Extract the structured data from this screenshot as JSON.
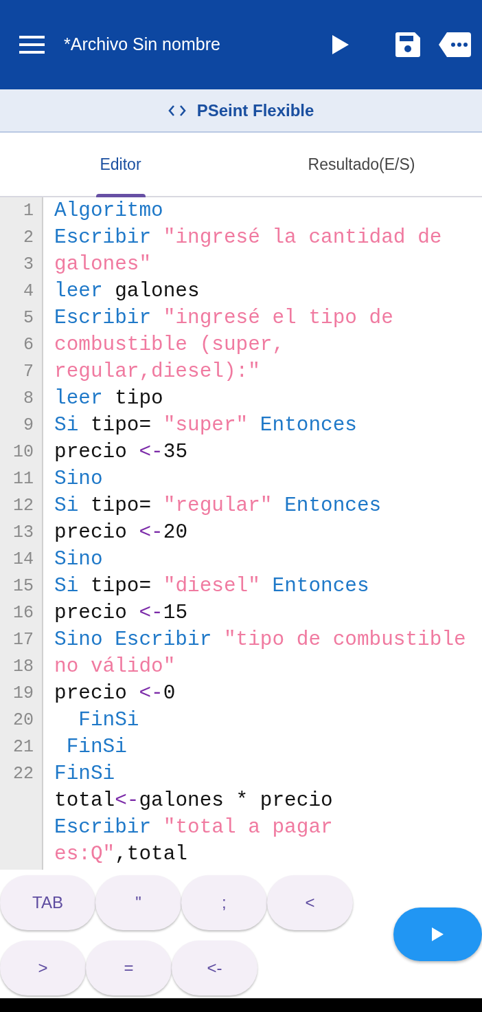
{
  "app_bar": {
    "title": "*Archivo Sin nombre"
  },
  "subheader": {
    "title": "PSeint Flexible"
  },
  "tabs": [
    {
      "label": "Editor",
      "selected": true
    },
    {
      "label": "Resultado(E/S)",
      "selected": false
    }
  ],
  "editor": {
    "rows": [
      {
        "number": "1",
        "tokens": [
          {
            "kind": "keyword",
            "text": "Algoritmo"
          }
        ]
      },
      {
        "number": "2",
        "tokens": [
          {
            "kind": "keyword",
            "text": "Escribir "
          },
          {
            "kind": "string",
            "text": "\"ingresé la cantidad de"
          }
        ]
      },
      {
        "number": "3",
        "tokens": [
          {
            "kind": "string",
            "text": "galones\""
          }
        ]
      },
      {
        "number": "4",
        "tokens": [
          {
            "kind": "keyword",
            "text": "leer "
          },
          {
            "kind": "plain",
            "text": "galones"
          }
        ]
      },
      {
        "number": "5",
        "tokens": [
          {
            "kind": "keyword",
            "text": "Escribir "
          },
          {
            "kind": "string",
            "text": "\"ingresé el tipo de"
          }
        ]
      },
      {
        "number": "6",
        "tokens": [
          {
            "kind": "string",
            "text": "combustible (super,"
          }
        ]
      },
      {
        "number": "7",
        "tokens": [
          {
            "kind": "string",
            "text": "regular,diesel):\""
          }
        ]
      },
      {
        "number": "8",
        "tokens": [
          {
            "kind": "keyword",
            "text": "leer "
          },
          {
            "kind": "plain",
            "text": "tipo"
          }
        ]
      },
      {
        "number": "9",
        "tokens": [
          {
            "kind": "keyword",
            "text": "Si "
          },
          {
            "kind": "plain",
            "text": "tipo= "
          },
          {
            "kind": "string",
            "text": "\"super\" "
          },
          {
            "kind": "keyword",
            "text": "Entonces"
          }
        ]
      },
      {
        "number": "10",
        "tokens": [
          {
            "kind": "plain",
            "text": "precio "
          },
          {
            "kind": "operator",
            "text": "<-"
          },
          {
            "kind": "plain",
            "text": "35"
          }
        ]
      },
      {
        "number": "11",
        "tokens": [
          {
            "kind": "keyword",
            "text": "Sino"
          }
        ]
      },
      {
        "number": "12",
        "tokens": [
          {
            "kind": "keyword",
            "text": "Si "
          },
          {
            "kind": "plain",
            "text": "tipo= "
          },
          {
            "kind": "string",
            "text": "\"regular\" "
          },
          {
            "kind": "keyword",
            "text": "Entonces"
          }
        ]
      },
      {
        "number": "13",
        "tokens": [
          {
            "kind": "plain",
            "text": "precio "
          },
          {
            "kind": "operator",
            "text": "<-"
          },
          {
            "kind": "plain",
            "text": "20"
          }
        ]
      },
      {
        "number": "14",
        "tokens": [
          {
            "kind": "keyword",
            "text": "Sino"
          }
        ]
      },
      {
        "number": "15",
        "tokens": [
          {
            "kind": "keyword",
            "text": "Si "
          },
          {
            "kind": "plain",
            "text": "tipo= "
          },
          {
            "kind": "string",
            "text": "\"diesel\" "
          },
          {
            "kind": "keyword",
            "text": "Entonces"
          }
        ]
      },
      {
        "number": "16",
        "tokens": [
          {
            "kind": "plain",
            "text": "precio "
          },
          {
            "kind": "operator",
            "text": "<-"
          },
          {
            "kind": "plain",
            "text": "15"
          }
        ]
      },
      {
        "number": "17",
        "tokens": [
          {
            "kind": "keyword",
            "text": "Sino Escribir "
          },
          {
            "kind": "string",
            "text": "\"tipo de combustible"
          }
        ]
      },
      {
        "number": "18",
        "tokens": [
          {
            "kind": "string",
            "text": "no válido\""
          }
        ]
      },
      {
        "number": "19",
        "tokens": [
          {
            "kind": "plain",
            "text": "precio "
          },
          {
            "kind": "operator",
            "text": "<-"
          },
          {
            "kind": "plain",
            "text": "0"
          }
        ]
      },
      {
        "number": "20",
        "tokens": [
          {
            "kind": "keyword",
            "text": "  FinSi"
          }
        ]
      },
      {
        "number": "21",
        "tokens": [
          {
            "kind": "keyword",
            "text": " FinSi"
          }
        ]
      },
      {
        "number": "22",
        "tokens": [
          {
            "kind": "keyword",
            "text": "FinSi"
          }
        ]
      },
      {
        "tokens": [
          {
            "kind": "plain",
            "text": "total"
          },
          {
            "kind": "operator",
            "text": "<-"
          },
          {
            "kind": "plain",
            "text": "galones * precio"
          }
        ]
      },
      {
        "tokens": [
          {
            "kind": "keyword",
            "text": "Escribir "
          },
          {
            "kind": "string",
            "text": "\"total a pagar"
          }
        ]
      },
      {
        "tokens": [
          {
            "kind": "string",
            "text": "es:Q\""
          },
          {
            "kind": "plain",
            "text": ",total"
          }
        ]
      }
    ]
  },
  "keys": [
    [
      "TAB",
      "\"",
      ";",
      "<"
    ],
    [
      ">",
      "=",
      "<-"
    ]
  ]
}
